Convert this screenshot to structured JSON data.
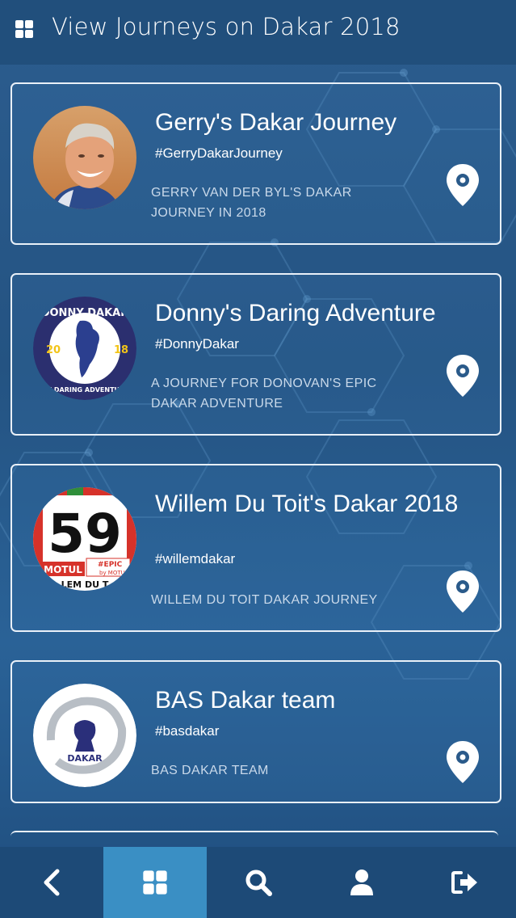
{
  "header": {
    "title": "View Journeys on Dakar 2018",
    "menu_icon": "grid-icon"
  },
  "journeys": [
    {
      "title": "Gerry's Dakar Journey",
      "tag": "#GerryDakarJourney",
      "description": "GERRY VAN DER BYL'S DAKAR JOURNEY IN 2018",
      "avatar": "portrait-photo"
    },
    {
      "title": "Donny's Daring Adventure",
      "tag": "#DonnyDakar",
      "description": "A JOURNEY FOR DONOVAN'S EPIC DAKAR ADVENTURE",
      "avatar": "donny-dakar-logo",
      "logo_text": {
        "top": "DONNY DAKAR",
        "left": "20",
        "right": "18",
        "bottom": "MY DARING ADVENTURE"
      }
    },
    {
      "title": "Willem Du Toit's Dakar 2018",
      "tag": "#willemdakar",
      "description": "WILLEM DU TOIT DAKAR JOURNEY",
      "avatar": "race-number-59",
      "logo_text": {
        "number": "59",
        "sponsor": "MOTUL",
        "epic": "#EPIC",
        "by": "by MOTUL",
        "name": "LEM DU T"
      }
    },
    {
      "title": "BAS Dakar team",
      "tag": "#basdakar",
      "description": "BAS DAKAR TEAM",
      "avatar": "dakar-logo",
      "logo_text": {
        "brand": "DAKAR"
      }
    }
  ],
  "bottom_nav": [
    {
      "icon": "chevron-left-icon",
      "active": false
    },
    {
      "icon": "grid-icon",
      "active": true
    },
    {
      "icon": "search-icon",
      "active": false
    },
    {
      "icon": "user-icon",
      "active": false
    },
    {
      "icon": "logout-icon",
      "active": false
    }
  ],
  "colors": {
    "header_bg": "#214f7c",
    "bottom_bar_bg": "#1d4a77",
    "active_nav_bg": "#3a8fc4",
    "card_border": "#e9f0f8",
    "description_text": "#c9d9ea"
  }
}
